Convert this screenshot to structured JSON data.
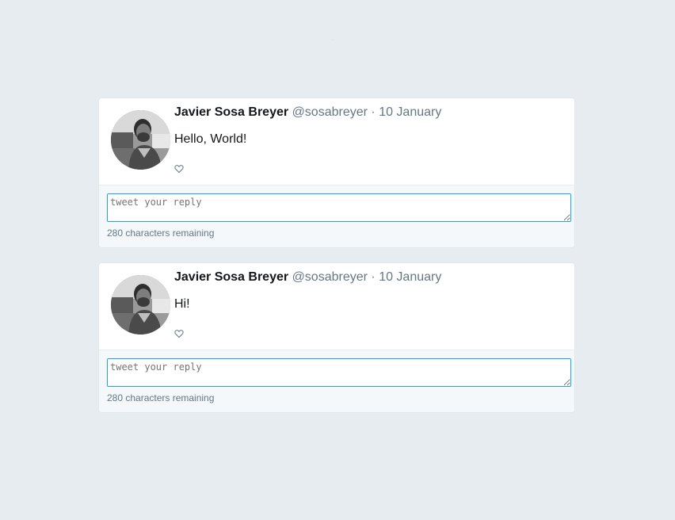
{
  "tweets": [
    {
      "author": {
        "name": "Javier Sosa Breyer",
        "handle": "@sosabreyer"
      },
      "separator": "·",
      "date": "10 January",
      "text": "Hello, World!",
      "like_icon": "heart-outline-icon",
      "reply": {
        "value": "",
        "placeholder": "tweet your reply",
        "remaining_text": "280 characters remaining"
      }
    },
    {
      "author": {
        "name": "Javier Sosa Breyer",
        "handle": "@sosabreyer"
      },
      "separator": "·",
      "date": "10 January",
      "text": "Hi!",
      "like_icon": "heart-outline-icon",
      "reply": {
        "value": "",
        "placeholder": "tweet your reply",
        "remaining_text": "280 characters remaining"
      }
    }
  ],
  "colors": {
    "background": "#e6ecf0",
    "card": "#ffffff",
    "reply_area": "#f5f8fa",
    "accent": "#1da1f2",
    "muted": "#657786"
  }
}
